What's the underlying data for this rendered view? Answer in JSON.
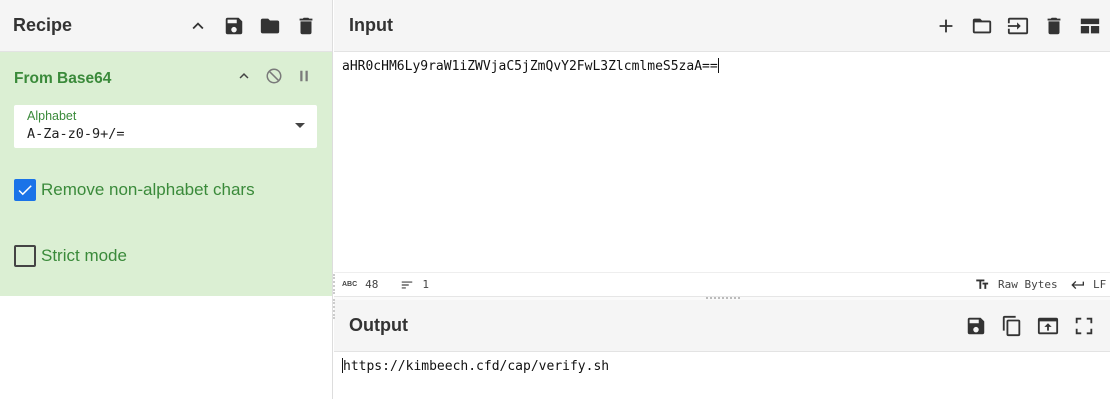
{
  "recipe": {
    "title": "Recipe",
    "header_icons": [
      "chevron-up-icon",
      "save-icon",
      "folder-icon",
      "trash-icon"
    ],
    "operation": {
      "name": "From Base64",
      "alphabet_label": "Alphabet",
      "alphabet_value": "A-Za-z0-9+/=",
      "remove_non_alphabet_label": "Remove non-alphabet chars",
      "remove_non_alphabet_checked": true,
      "strict_mode_label": "Strict mode",
      "strict_mode_checked": false
    }
  },
  "input": {
    "title": "Input",
    "text": "aHR0cHM6Ly9raW1iZWVjaC5jZmQvY2FwL3ZlcmlmeS5zaA==",
    "status": {
      "length": "48",
      "lines": "1",
      "encoding": "Raw Bytes",
      "eol": "LF"
    },
    "header_icons": [
      "plus-icon",
      "folder-icon",
      "import-icon",
      "trash-icon",
      "layout-icon"
    ]
  },
  "output": {
    "title": "Output",
    "text": "https://kimbeech.cfd/cap/verify.sh",
    "header_icons": [
      "save-icon",
      "copy-icon",
      "replace-input-icon",
      "fullscreen-icon"
    ]
  }
}
